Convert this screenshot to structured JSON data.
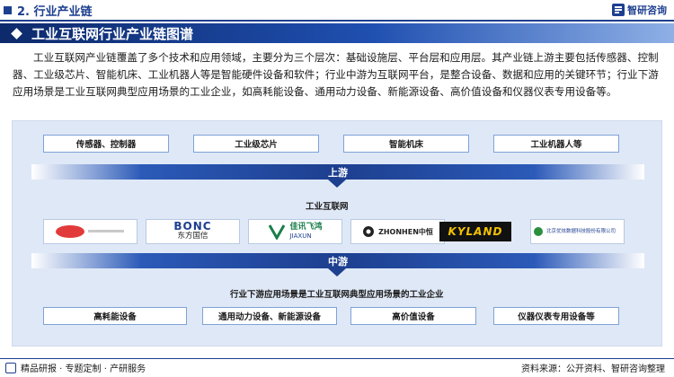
{
  "header": {
    "section_title": "2. 行业产业链",
    "brand_name": "智研咨询"
  },
  "banner": {
    "title": "工业互联网行业产业链图谱"
  },
  "intro_text": "工业互联网产业链覆盖了多个技术和应用领域，主要分为三个层次：基础设施层、平台层和应用层。其产业链上游主要包括传感器、控制器、工业级芯片、智能机床、工业机器人等是智能硬件设备和软件；行业中游为互联网平台，是整合设备、数据和应用的关键环节；行业下游应用场景是工业互联网典型应用场景的工业企业，如高耗能设备、通用动力设备、新能源设备、高价值设备和仪器仪表专用设备等。",
  "upstream": {
    "items": [
      "传感器、控制器",
      "工业级芯片",
      "智能机床",
      "工业机器人等"
    ],
    "stage_label": "上游"
  },
  "midstream": {
    "title": "工业互联网",
    "logos": [
      {
        "name": "company-logo-1",
        "text": ""
      },
      {
        "name": "bonc-logo",
        "text": "BONC",
        "subtext": "东方国信"
      },
      {
        "name": "jiaxun-logo",
        "text": "佳讯飞鸿",
        "subtext": "JIAXUN"
      },
      {
        "name": "zhonghen-logo",
        "text": "ZHONHEN中恒"
      },
      {
        "name": "kyland-logo",
        "text": "KYLAND"
      },
      {
        "name": "beijing-logo",
        "text": "北京优炫数据科技股份有限公司"
      }
    ],
    "stage_label": "中游"
  },
  "downstream": {
    "title": "行业下游应用场景是工业互联网典型应用场景的工业企业",
    "items": [
      "高耗能设备",
      "通用动力设备、新能源设备",
      "高价值设备",
      "仪器仪表专用设备等"
    ]
  },
  "footer": {
    "left": "精品研报 · 专题定制 · 产研服务",
    "right": "资料来源：公开资料、智研咨询整理"
  },
  "colors": {
    "primary": "#1d3f8f",
    "panel": "#dfe8f6",
    "box_border": "#7ea2d8"
  }
}
